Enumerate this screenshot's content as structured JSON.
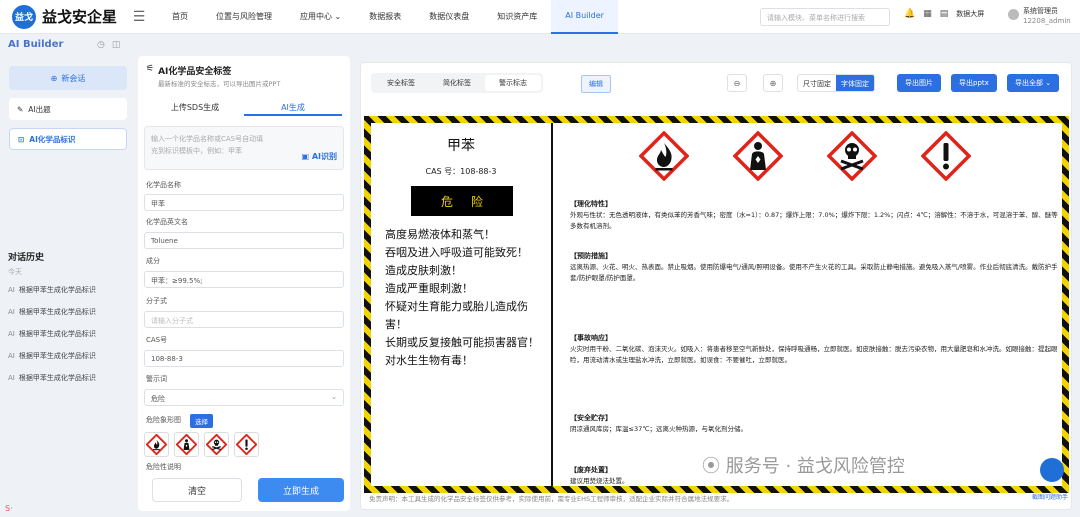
{
  "app": {
    "logo_mark": "益戈",
    "title": "益戈安企星"
  },
  "nav": [
    "首页",
    "位置与风险管理",
    "应用中心",
    "数据报表",
    "数据仪表盘",
    "知识资产库",
    "AI Builder"
  ],
  "nav_active": 6,
  "search": {
    "placeholder": "请输入模块、菜单名称进行搜索"
  },
  "header": {
    "bigscreen": "数据大屏",
    "user_name": "系统管理员",
    "user_id": "12208_admin"
  },
  "sidebar": {
    "title": "AI Builder",
    "new_chat": "新会话",
    "items": [
      {
        "label": "AI出题"
      },
      {
        "label": "AI化学品标识"
      }
    ],
    "history_title": "对话历史",
    "history_today": "今天",
    "history": [
      "根据甲苯生成化学品标识",
      "根据甲苯生成化学品标识",
      "根据甲苯生成化学品标识",
      "根据甲苯生成化学品标识",
      "根据甲苯生成化学品标识"
    ]
  },
  "form": {
    "title": "AI化学品安全标签",
    "subtitle": "最新标准的安全标志，可以导出图片或PPT",
    "tabs": [
      "上传SDS生成",
      "AI生成"
    ],
    "ai_placeholder_1": "输入一个化学品名称或CAS号自动填",
    "ai_placeholder_2": "充到标识模板中，例如：甲苯",
    "ai_button": "AI识别",
    "fields": {
      "name_label": "化学品名称",
      "name_value": "甲苯",
      "en_label": "化学品英文名",
      "en_value": "Toluene",
      "comp_label": "成分",
      "comp_value": "甲苯：≥99.5%;",
      "formula_label": "分子式",
      "formula_placeholder": "请输入分子式",
      "cas_label": "CAS号",
      "cas_value": "108-88-3",
      "signal_label": "警示词",
      "signal_value": "危险",
      "pict_label": "危险象形图",
      "pict_button": "选择",
      "desc_label": "危险性说明"
    },
    "clear": "清空",
    "generate": "立即生成"
  },
  "preview": {
    "tabs": [
      "安全标签",
      "简化标签",
      "警示标志"
    ],
    "active_tab": 2,
    "edit": "编辑",
    "zoom_out": "⊖",
    "zoom_in": "⊕",
    "size_options": [
      "尺寸固定",
      "字体固定"
    ],
    "size_active": 1,
    "export_image": "导出图片",
    "export_ppt": "导出pptx",
    "export_all": "导出全部 ⌄",
    "disclaimer": "免责声明：本工具生成的化学品安全标签仅供参考，实际使用前，需专业EHS工程师审核，适配企业实际并符合属地法规要求。"
  },
  "label": {
    "name": "甲苯",
    "cas": "CAS 号：108-88-3",
    "signal": "危险",
    "hazards": [
      "高度易燃液体和蒸气！",
      "吞咽及进入呼吸道可能致死！",
      "造成皮肤刺激！",
      "造成严重眼刺激！",
      "怀疑对生育能力或胎儿造成伤害！",
      "长期或反复接触可能损害器官！",
      "对水生生物有毒！"
    ],
    "pictograms": [
      "flame-icon",
      "health-hazard-icon",
      "skull-icon",
      "exclamation-icon"
    ],
    "sections": [
      {
        "title": "【理化特性】",
        "text": "外观与性状：无色透明液体，有类似苯的芳香气味；密度（水=1）：0.87；爆炸上限：7.0%；爆炸下限：1.2%；闪点：4℃；溶解性：不溶于水，可混溶于苯、醇、醚等多数有机溶剂。"
      },
      {
        "title": "【预防措施】",
        "text": "远离热源、火花、明火、热表面。禁止吸烟。使用防爆电气/通风/照明设备。使用不产生火花的工具。采取防止静电措施。避免吸入蒸气/喷雾。作业后彻底清洗。戴防护手套/防护眼罩/防护面罩。"
      },
      {
        "title": "【事故响应】",
        "text": "火灾时用干粉、二氧化碳、泡沫灭火。如吸入：将患者移至空气新鲜处，保持呼吸通畅，立即就医。如皮肤接触：脱去污染衣物，用大量肥皂和水冲洗。如眼接触：提起眼睑，用流动清水或生理盐水冲洗，立即就医。如误食：不要催吐，立即就医。"
      },
      {
        "title": "【安全贮存】",
        "text": "阴凉通风库房；库温≤37℃；远离火种热源，与氧化剂分储。"
      },
      {
        "title": "【废弃处置】",
        "text": "建议用焚烧法处置。"
      }
    ]
  },
  "overlay": {
    "watermark": "服务号 · 益戈风险管控",
    "badge": "截图问题助手"
  },
  "colors": {
    "primary": "#2b6fe0",
    "danger_red": "#e2231a",
    "warning_yellow": "#f2d400"
  }
}
